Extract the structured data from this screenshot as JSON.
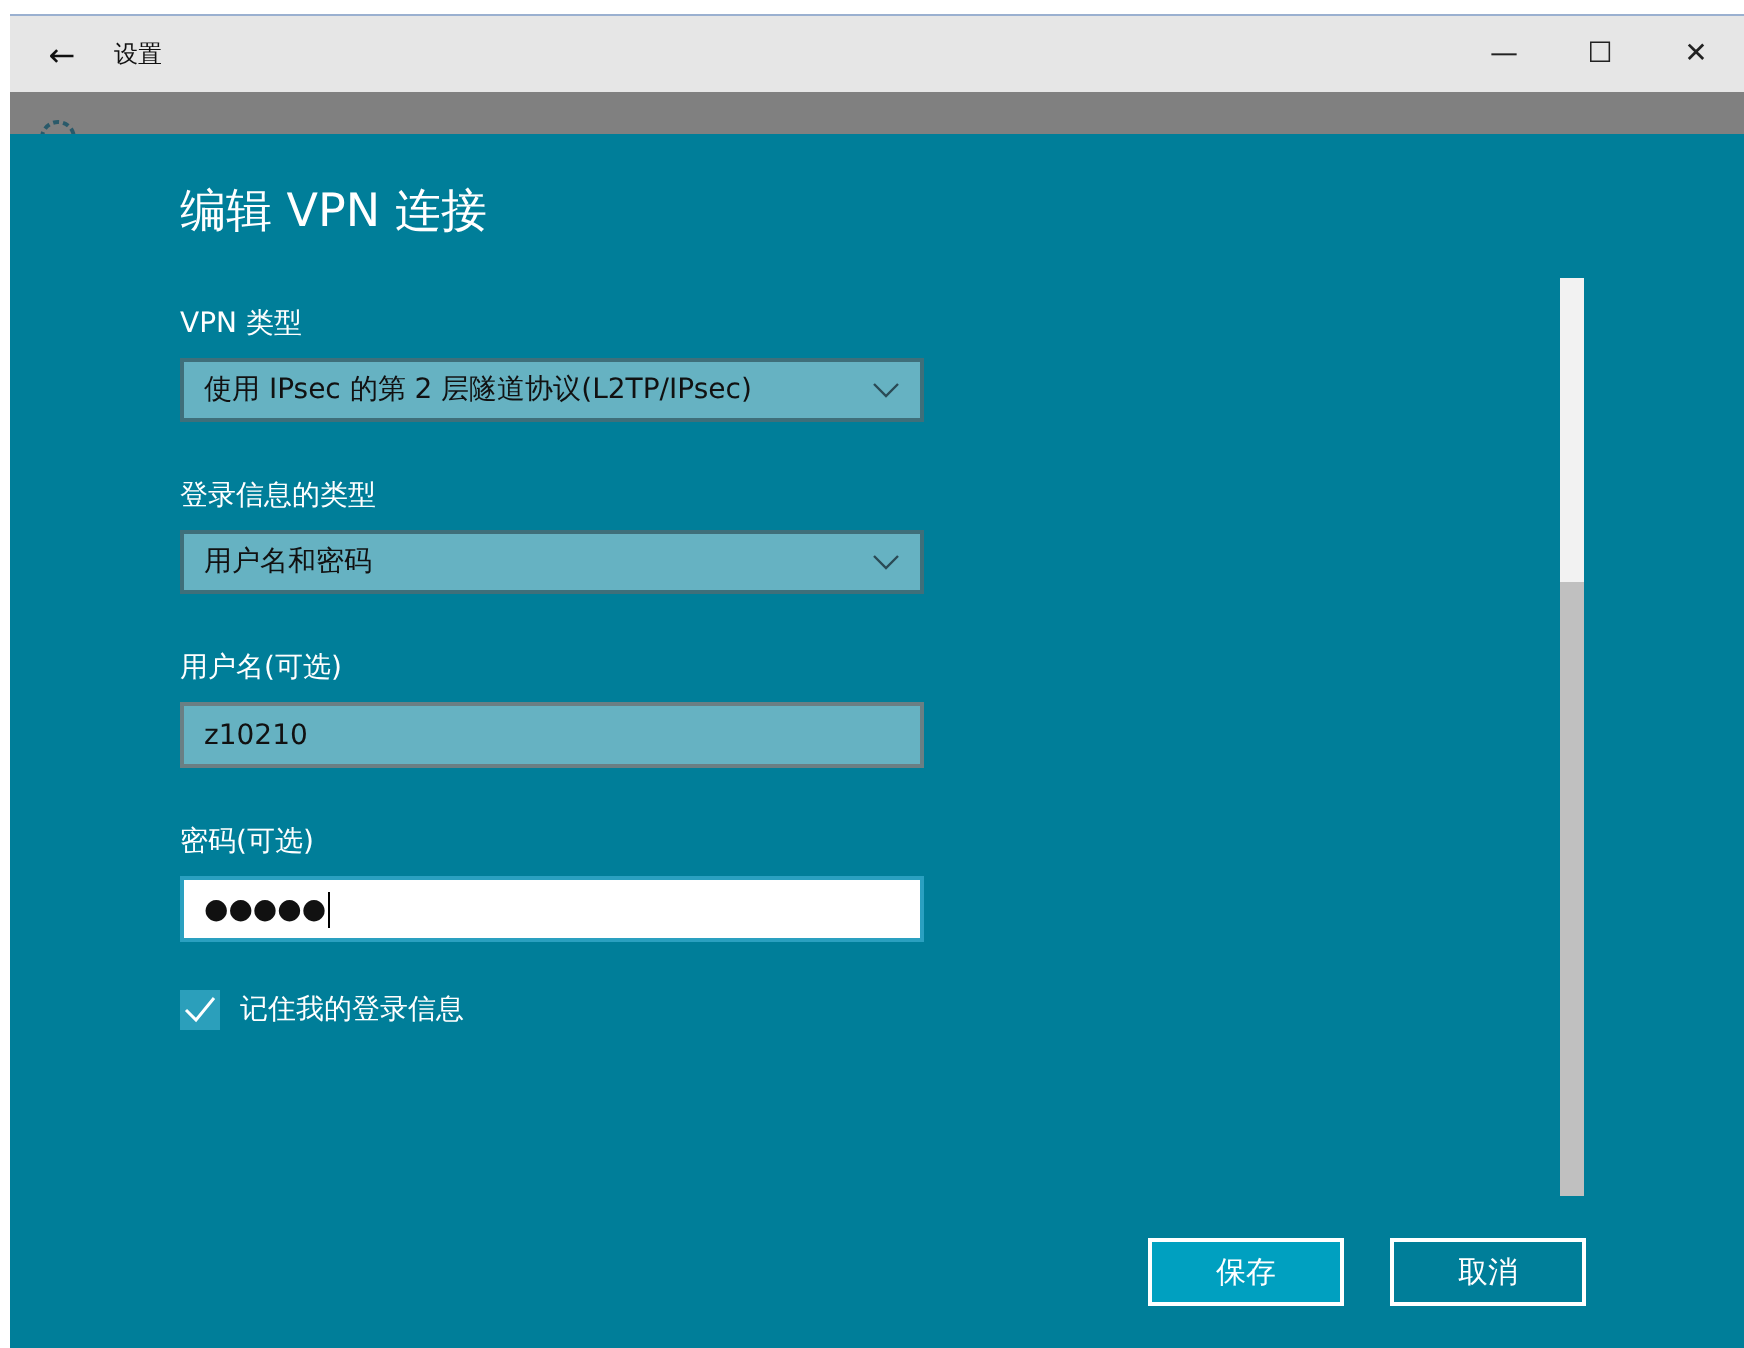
{
  "window": {
    "title": "设置",
    "back": "←",
    "controls": [
      "—",
      "☐",
      "✕"
    ]
  },
  "dialog": {
    "title": "编辑 VPN 连接",
    "fields": [
      {
        "kind": "dropdown",
        "label": "VPN 类型",
        "value": "使用 IPsec 的第 2 层隧道协议(L2TP/IPsec)"
      },
      {
        "kind": "dropdown",
        "label": "登录信息的类型",
        "value": "用户名和密码"
      },
      {
        "kind": "text",
        "label": "用户名(可选)",
        "value": "z10210",
        "focused": false
      },
      {
        "kind": "password",
        "label": "密码(可选)",
        "value": "●●●●●",
        "focused": true
      }
    ],
    "remember": {
      "label": "记住我的登录信息",
      "checked": true
    },
    "buttons": [
      {
        "label": "保存",
        "primary": true
      },
      {
        "label": "取消",
        "primary": false
      }
    ]
  }
}
